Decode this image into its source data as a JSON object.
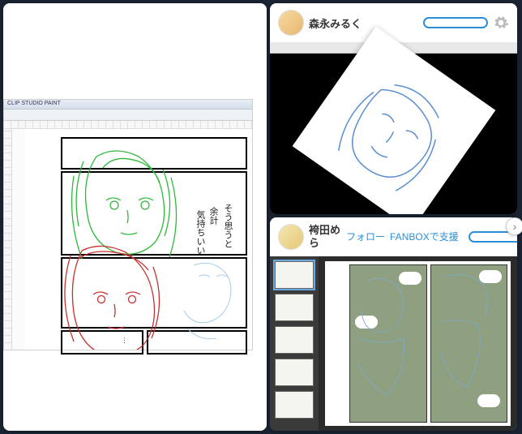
{
  "left": {
    "app_title": "CLIP STUDIO PAINT",
    "dialogue1": "そう思うと",
    "dialogue2": "余計",
    "dialogue3": "気持ちいい",
    "ellipsis": "…"
  },
  "streams": [
    {
      "username": "森永みるく",
      "follow_label": null,
      "support_label": null
    },
    {
      "username": "袴田めら",
      "follow_label": "フォロー",
      "support_label": "FANBOXで支援"
    }
  ],
  "colors": {
    "accent": "#2a8fd6",
    "line_green": "#2eb83a",
    "line_red": "#c73030"
  },
  "pager_glyph": "›"
}
